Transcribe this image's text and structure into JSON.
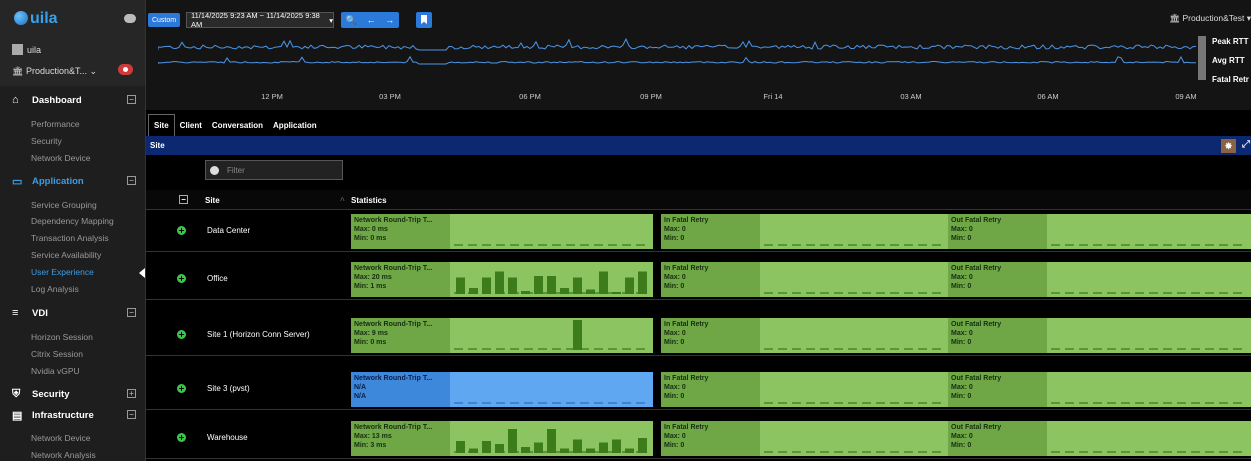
{
  "sidebar": {
    "app_name": "uila",
    "user": "uila",
    "tenant": "Production&T...",
    "sections": [
      {
        "label": "Dashboard",
        "icon": "home-icon",
        "items": [
          "Performance",
          "Security",
          "Network Device"
        ]
      },
      {
        "label": "Application",
        "icon": "monitor-icon",
        "items": [
          "Service Grouping",
          "Dependency Mapping",
          "Transaction Analysis",
          "Service Availability",
          "User Experience",
          "Log Analysis"
        ],
        "active_item": "User Experience"
      },
      {
        "label": "VDI",
        "icon": "vdi-icon",
        "items": [
          "Horizon Session",
          "Citrix Session",
          "Nvidia vGPU"
        ]
      },
      {
        "label": "Security",
        "icon": "shield-icon",
        "items": []
      },
      {
        "label": "Infrastructure",
        "icon": "chart-icon",
        "items": [
          "Network Device",
          "Network Analysis"
        ]
      }
    ]
  },
  "topbar": {
    "custom_label": "Custom",
    "date_range": "11/14/2025 9:23 AM ~ 11/14/2025 9:38 AM",
    "tenant": "Production&Test",
    "legend": [
      "Peak RTT",
      "Avg RTT",
      "Fatal Retr"
    ],
    "time_ticks": [
      "12 PM",
      "03 PM",
      "06 PM",
      "09 PM",
      "Fri 14",
      "03 AM",
      "06 AM",
      "09 AM"
    ]
  },
  "tabs": [
    "Site",
    "Client",
    "Conversation",
    "Application"
  ],
  "active_tab": "Site",
  "section_title": "Site",
  "filter_placeholder": "Filter",
  "table": {
    "col_site": "Site",
    "col_stats": "Statistics",
    "rows": [
      {
        "name": "Data Center",
        "rtt": {
          "title": "Network Round-Trip T...",
          "max": "Max: 0 ms",
          "min": "Min: 0 ms",
          "bars": [],
          "na": false
        },
        "in_fatal": {
          "title": "In Fatal Retry",
          "max": "Max: 0",
          "min": "Min: 0"
        },
        "out_fatal": {
          "title": "Out Fatal Retry",
          "max": "Max: 0",
          "min": "Min: 0"
        }
      },
      {
        "name": "Office",
        "rtt": {
          "title": "Network Round-Trip T...",
          "max": "Max: 20 ms",
          "min": "Min: 1 ms",
          "bars": [
            0.55,
            0.2,
            0.55,
            0.75,
            0.55,
            0.1,
            0.6,
            0.6,
            0.2,
            0.55,
            0.15,
            0.75,
            0.05,
            0.55,
            0.75
          ],
          "na": false
        },
        "in_fatal": {
          "title": "In Fatal Retry",
          "max": "Max: 0",
          "min": "Min: 0"
        },
        "out_fatal": {
          "title": "Out Fatal Retry",
          "max": "Max: 0",
          "min": "Min: 0"
        }
      },
      {
        "name": "Site 1 (Horizon Conn Server)",
        "rtt": {
          "title": "Network Round-Trip T...",
          "max": "Max: 9 ms",
          "min": "Min: 0 ms",
          "bars": [
            0,
            0,
            0,
            0,
            0,
            0,
            0,
            0,
            0,
            1,
            0,
            0,
            0,
            0,
            0
          ],
          "na": false
        },
        "in_fatal": {
          "title": "In Fatal Retry",
          "max": "Max: 0",
          "min": "Min: 0"
        },
        "out_fatal": {
          "title": "Out Fatal Retry",
          "max": "Max: 0",
          "min": "Min: 0"
        }
      },
      {
        "name": "Site 3 (pvst)",
        "rtt": {
          "title": "Network Round-Trip T...",
          "max": "N/A",
          "min": "N/A",
          "bars": [],
          "na": true
        },
        "in_fatal": {
          "title": "In Fatal Retry",
          "max": "Max: 0",
          "min": "Min: 0"
        },
        "out_fatal": {
          "title": "Out Fatal Retry",
          "max": "Max: 0",
          "min": "Min: 0"
        }
      },
      {
        "name": "Warehouse",
        "rtt": {
          "title": "Network Round-Trip T...",
          "max": "Max: 13 ms",
          "min": "Min: 3 ms",
          "bars": [
            0.4,
            0.15,
            0.4,
            0.3,
            0.8,
            0.2,
            0.35,
            0.8,
            0.15,
            0.45,
            0.15,
            0.35,
            0.45,
            0.15,
            0.5
          ],
          "na": false
        },
        "in_fatal": {
          "title": "In Fatal Retry",
          "max": "Max: 0",
          "min": "Min: 0"
        },
        "out_fatal": {
          "title": "Out Fatal Retry",
          "max": "Max: 0",
          "min": "Min: 0"
        }
      }
    ]
  },
  "colors": {
    "accent": "#2b79d8",
    "site_bar": "#0b2870",
    "ok_green": "#8cc462",
    "bar_green": "#3d7c1a",
    "na_blue": "#60a7f2"
  }
}
